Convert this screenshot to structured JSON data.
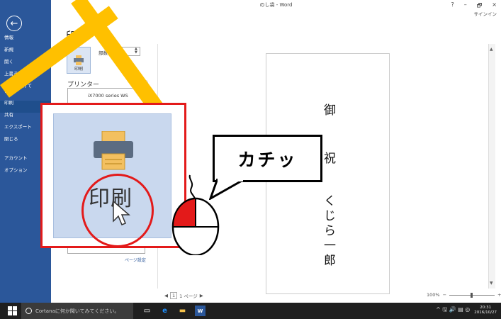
{
  "window": {
    "title": "のし袋 - Word",
    "help": "?",
    "minimize": "–",
    "restore": "🗗",
    "close": "×",
    "signin": "サインイン"
  },
  "sidebar": {
    "back_icon": "←",
    "items": [
      {
        "label": "情報"
      },
      {
        "label": "新規"
      },
      {
        "label": "開く"
      },
      {
        "label": "上書き保存"
      },
      {
        "label": "名前を付けて\n保存"
      },
      {
        "label": "印刷",
        "active": true
      },
      {
        "label": "共有"
      },
      {
        "label": "エクスポート"
      },
      {
        "label": "閉じる"
      },
      {
        "label": "アカウント"
      },
      {
        "label": "オプション"
      }
    ]
  },
  "print": {
    "title": "印刷",
    "button_label": "印刷",
    "copies_label": "部数:",
    "copies_value": "1",
    "printer_heading": "プリンター",
    "printer_name": "iX7000 series WS",
    "info_icon": "ⓘ",
    "page_setup": "ページ設定"
  },
  "preview": {
    "lines": [
      "御",
      "祝",
      "くじら一郎"
    ],
    "page_current": "1",
    "page_total": "1 ページ",
    "prev": "◀",
    "next": "▶",
    "zoom": "100%",
    "zoom_minus": "−",
    "zoom_plus": "+"
  },
  "overlay": {
    "zoom_label": "印刷",
    "bubble_text": "カチッ",
    "accent_red": "#e31a1a",
    "stripe_yellow": "#ffc000"
  },
  "taskbar": {
    "search_placeholder": "Cortanaに何か聞いてみてください。",
    "word_icon_label": "W",
    "edge_icon": "e",
    "time": "20:31",
    "date": "2016/10/27",
    "tray": "^ 🖫 🔊 ▤ ◎"
  }
}
